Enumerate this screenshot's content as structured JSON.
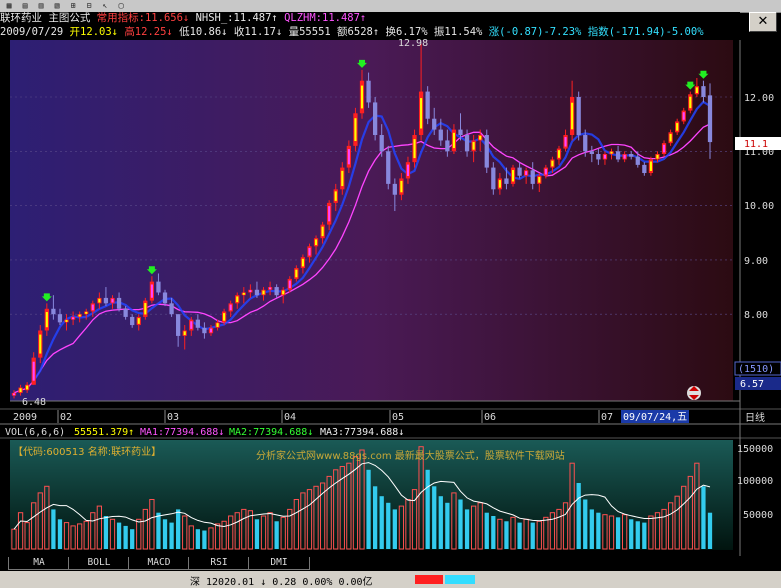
{
  "stock_name": "联环药业",
  "formula_label": "主图公式",
  "indicator_label": "常用指标:11.656↓",
  "nhsh_label": "NHSH_:11.487↑",
  "qlzhm_label": "QLZHM:11.487↑",
  "quote": {
    "date": "2009/07/29",
    "open": "开12.03↓",
    "high": "高12.25↓",
    "low": "低10.86↓",
    "close": "收11.17↓",
    "volume": "量55551",
    "amount": "额6528↑",
    "turnover": "换6.17%",
    "amplitude": "振11.54%",
    "change": "涨(-0.87)-7.23%",
    "index": "指数(-171.94)-5.00%"
  },
  "price_axis": [
    "12.00",
    "11.00",
    "10.00",
    "9.00",
    "8.00"
  ],
  "price_marker": "11.1",
  "high_mark": "12.98",
  "low_mark": "6.48",
  "side_label_1": "(1510)",
  "side_label_2": "6.57",
  "date_axis": [
    "2009",
    "02",
    "03",
    "04",
    "05",
    "06",
    "07"
  ],
  "cursor_date": "09/07/24,五",
  "period_label": "日线",
  "vol_header": {
    "name": "VOL(6,6,6)",
    "value": "55551.379↑",
    "ma1": "MA1:77394.688↓",
    "ma2": "MA2:77394.688↓",
    "ma3": "MA3:77394.688↓"
  },
  "info_code": "【代码:600513 名称:联环药业】",
  "watermark": "分析家公式网www.88gs.com 最新最大股票公式，股票软件下载网站",
  "volume_axis": [
    "150000",
    "100000",
    "50000"
  ],
  "tabs": [
    "MA",
    "BOLL",
    "MACD",
    "RSI",
    "DMI"
  ],
  "status": "深 12020.01 ↓ 0.28 0.00% 0.00亿",
  "colors": {
    "up": "#ff2020",
    "down": "#8888dd",
    "yellow": "#ffff00",
    "magenta": "#ff44ff",
    "blue_ma": "#2244ff",
    "vol_up": "#ff5050",
    "vol_down": "#33ccee"
  },
  "chart_data": {
    "type": "candlestick",
    "y_range": [
      6.2,
      12.6
    ],
    "candles": [
      [
        6.5,
        6.6,
        6.45,
        6.55
      ],
      [
        6.55,
        6.7,
        6.5,
        6.65
      ],
      [
        6.6,
        6.75,
        6.55,
        6.7
      ],
      [
        6.7,
        7.3,
        6.7,
        7.2
      ],
      [
        7.2,
        7.8,
        7.1,
        7.7
      ],
      [
        7.7,
        8.2,
        7.6,
        8.1
      ],
      [
        8.1,
        8.35,
        7.9,
        8.0
      ],
      [
        8.0,
        8.1,
        7.8,
        7.85
      ],
      [
        7.85,
        8.0,
        7.7,
        7.9
      ],
      [
        7.9,
        8.05,
        7.8,
        7.95
      ],
      [
        7.95,
        8.05,
        7.85,
        8.0
      ],
      [
        8.0,
        8.1,
        7.9,
        8.05
      ],
      [
        8.05,
        8.25,
        7.95,
        8.2
      ],
      [
        8.2,
        8.4,
        8.1,
        8.3
      ],
      [
        8.3,
        8.5,
        8.15,
        8.2
      ],
      [
        8.2,
        8.35,
        8.1,
        8.3
      ],
      [
        8.3,
        8.4,
        8.05,
        8.1
      ],
      [
        8.1,
        8.15,
        7.9,
        7.95
      ],
      [
        7.95,
        8.0,
        7.75,
        7.8
      ],
      [
        7.8,
        8.0,
        7.7,
        7.95
      ],
      [
        7.95,
        8.3,
        7.9,
        8.25
      ],
      [
        8.25,
        8.7,
        8.2,
        8.6
      ],
      [
        8.6,
        8.75,
        8.35,
        8.4
      ],
      [
        8.4,
        8.45,
        8.15,
        8.2
      ],
      [
        8.2,
        8.3,
        7.95,
        8.0
      ],
      [
        8.0,
        8.0,
        7.4,
        7.6
      ],
      [
        7.6,
        7.8,
        7.35,
        7.7
      ],
      [
        7.7,
        7.95,
        7.6,
        7.9
      ],
      [
        7.9,
        8.0,
        7.7,
        7.75
      ],
      [
        7.75,
        7.85,
        7.55,
        7.65
      ],
      [
        7.65,
        7.8,
        7.6,
        7.75
      ],
      [
        7.75,
        7.9,
        7.7,
        7.85
      ],
      [
        7.85,
        8.1,
        7.8,
        8.05
      ],
      [
        8.05,
        8.25,
        7.95,
        8.2
      ],
      [
        8.2,
        8.4,
        8.1,
        8.35
      ],
      [
        8.35,
        8.5,
        8.2,
        8.4
      ],
      [
        8.4,
        8.55,
        8.3,
        8.45
      ],
      [
        8.45,
        8.6,
        8.3,
        8.35
      ],
      [
        8.35,
        8.5,
        8.25,
        8.45
      ],
      [
        8.45,
        8.6,
        8.35,
        8.5
      ],
      [
        8.5,
        8.55,
        8.3,
        8.35
      ],
      [
        8.35,
        8.5,
        8.2,
        8.45
      ],
      [
        8.45,
        8.7,
        8.4,
        8.65
      ],
      [
        8.65,
        8.9,
        8.6,
        8.85
      ],
      [
        8.85,
        9.1,
        8.75,
        9.05
      ],
      [
        9.05,
        9.3,
        8.95,
        9.25
      ],
      [
        9.25,
        9.45,
        9.1,
        9.4
      ],
      [
        9.4,
        9.7,
        9.3,
        9.65
      ],
      [
        9.65,
        10.1,
        9.55,
        10.05
      ],
      [
        10.05,
        10.4,
        9.9,
        10.3
      ],
      [
        10.3,
        10.8,
        10.2,
        10.7
      ],
      [
        10.7,
        11.2,
        10.6,
        11.1
      ],
      [
        11.1,
        11.8,
        11.0,
        11.7
      ],
      [
        11.7,
        12.5,
        11.6,
        12.3
      ],
      [
        12.3,
        12.45,
        11.8,
        11.9
      ],
      [
        11.9,
        12.0,
        11.2,
        11.3
      ],
      [
        11.3,
        11.5,
        10.9,
        11.0
      ],
      [
        11.0,
        11.1,
        10.3,
        10.4
      ],
      [
        10.4,
        10.5,
        9.9,
        10.2
      ],
      [
        10.2,
        10.6,
        10.1,
        10.5
      ],
      [
        10.5,
        10.9,
        10.4,
        10.8
      ],
      [
        10.8,
        11.4,
        10.7,
        11.3
      ],
      [
        11.3,
        12.98,
        11.2,
        12.1
      ],
      [
        12.1,
        12.2,
        11.5,
        11.6
      ],
      [
        11.6,
        11.8,
        11.3,
        11.4
      ],
      [
        11.4,
        11.6,
        11.1,
        11.2
      ],
      [
        11.2,
        11.4,
        10.9,
        11.0
      ],
      [
        11.0,
        11.5,
        10.95,
        11.4
      ],
      [
        11.4,
        11.7,
        11.2,
        11.3
      ],
      [
        11.3,
        11.4,
        10.9,
        11.0
      ],
      [
        11.0,
        11.3,
        10.8,
        11.2
      ],
      [
        11.2,
        11.4,
        11.0,
        11.3
      ],
      [
        11.3,
        11.4,
        10.6,
        10.7
      ],
      [
        10.7,
        10.8,
        10.2,
        10.3
      ],
      [
        10.3,
        10.6,
        10.2,
        10.5
      ],
      [
        10.5,
        10.7,
        10.3,
        10.4
      ],
      [
        10.4,
        10.75,
        10.35,
        10.7
      ],
      [
        10.7,
        10.8,
        10.5,
        10.55
      ],
      [
        10.55,
        10.7,
        10.4,
        10.65
      ],
      [
        10.65,
        10.8,
        10.3,
        10.4
      ],
      [
        10.4,
        10.6,
        10.25,
        10.55
      ],
      [
        10.55,
        10.75,
        10.5,
        10.7
      ],
      [
        10.7,
        10.9,
        10.6,
        10.85
      ],
      [
        10.85,
        11.1,
        10.75,
        11.05
      ],
      [
        11.05,
        11.4,
        11.0,
        11.3
      ],
      [
        11.3,
        12.3,
        11.2,
        12.0
      ],
      [
        12.0,
        12.1,
        11.2,
        11.3
      ],
      [
        11.3,
        11.4,
        10.9,
        11.0
      ],
      [
        11.0,
        11.1,
        10.8,
        10.95
      ],
      [
        10.95,
        11.05,
        10.75,
        10.85
      ],
      [
        10.85,
        11.0,
        10.75,
        10.95
      ],
      [
        10.95,
        11.05,
        10.85,
        11.0
      ],
      [
        11.0,
        11.1,
        10.8,
        10.85
      ],
      [
        10.85,
        11.0,
        10.8,
        10.95
      ],
      [
        10.95,
        11.0,
        10.85,
        10.9
      ],
      [
        10.9,
        11.0,
        10.7,
        10.75
      ],
      [
        10.75,
        10.8,
        10.55,
        10.6
      ],
      [
        10.6,
        10.9,
        10.55,
        10.85
      ],
      [
        10.85,
        11.0,
        10.8,
        10.95
      ],
      [
        10.95,
        11.2,
        10.9,
        11.15
      ],
      [
        11.15,
        11.4,
        11.1,
        11.35
      ],
      [
        11.35,
        11.6,
        11.3,
        11.55
      ],
      [
        11.55,
        11.8,
        11.5,
        11.75
      ],
      [
        11.75,
        12.1,
        11.7,
        12.05
      ],
      [
        12.05,
        12.35,
        12.0,
        12.2
      ],
      [
        12.2,
        12.3,
        11.9,
        12.0
      ],
      [
        12.03,
        12.25,
        10.86,
        11.17
      ]
    ],
    "vol": [
      30,
      55,
      40,
      70,
      85,
      95,
      60,
      45,
      40,
      35,
      38,
      42,
      55,
      65,
      50,
      45,
      40,
      35,
      30,
      45,
      60,
      75,
      55,
      45,
      40,
      60,
      50,
      35,
      30,
      28,
      32,
      38,
      42,
      50,
      55,
      60,
      58,
      45,
      50,
      55,
      42,
      48,
      60,
      75,
      85,
      90,
      95,
      100,
      110,
      120,
      125,
      130,
      140,
      150,
      120,
      95,
      80,
      70,
      60,
      65,
      75,
      90,
      155,
      120,
      95,
      80,
      70,
      85,
      75,
      60,
      65,
      70,
      55,
      50,
      45,
      42,
      48,
      40,
      45,
      40,
      42,
      48,
      55,
      60,
      70,
      130,
      100,
      75,
      60,
      55,
      52,
      50,
      48,
      52,
      45,
      42,
      40,
      50,
      55,
      60,
      70,
      80,
      95,
      110,
      130,
      95,
      55
    ]
  }
}
